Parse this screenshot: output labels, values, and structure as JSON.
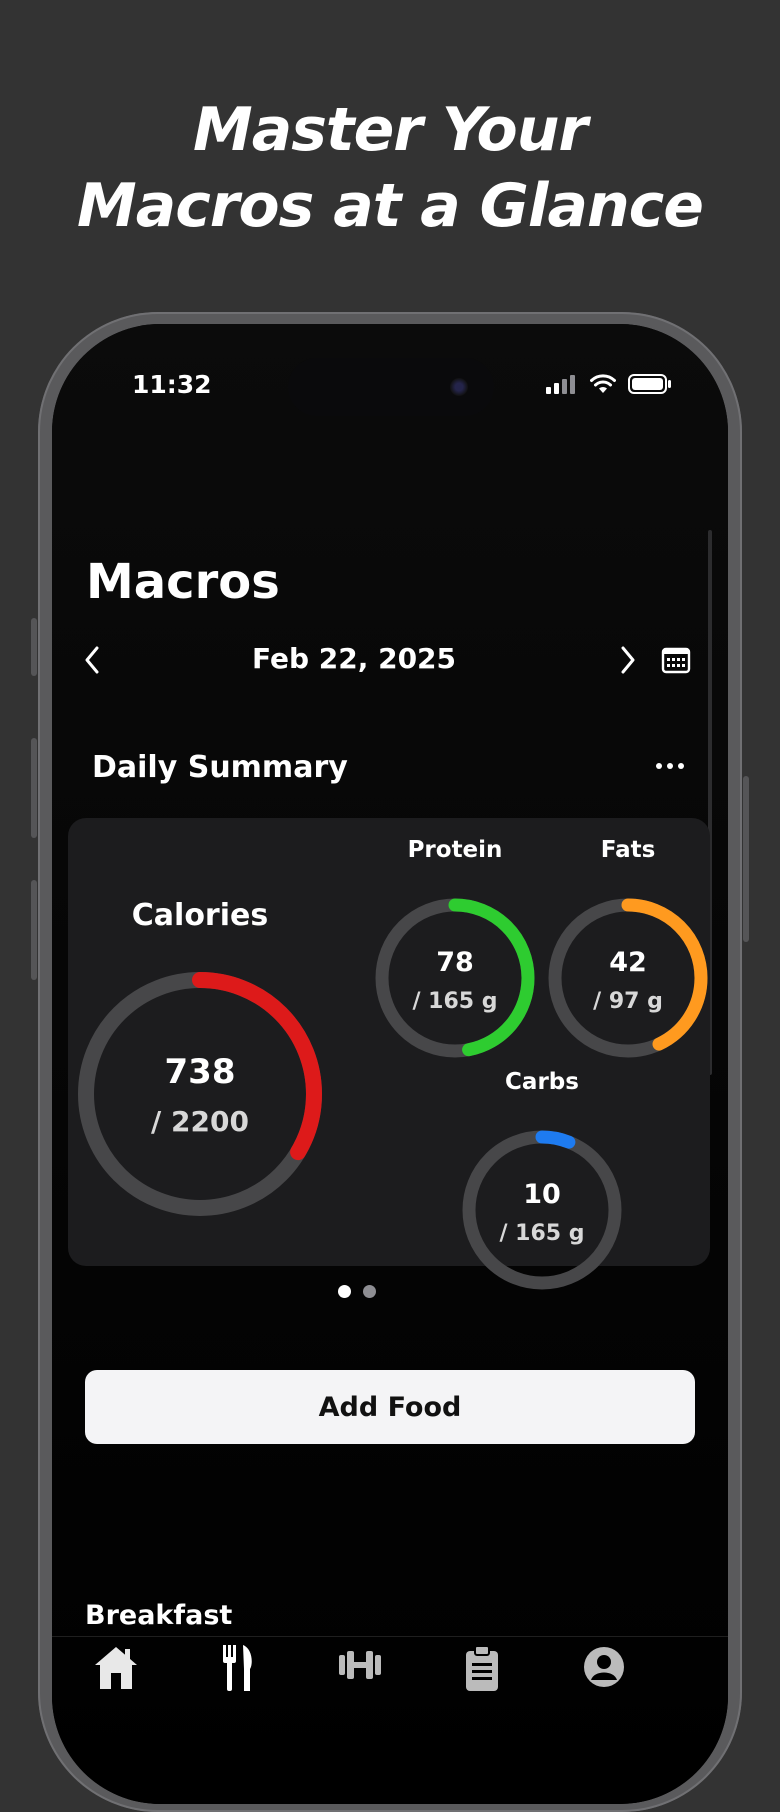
{
  "promo": {
    "headline_line1": "Master Your",
    "headline_line2": "Macros at a Glance"
  },
  "status_bar": {
    "time": "11:32"
  },
  "page": {
    "title": "Macros",
    "date": "Feb 22, 2025"
  },
  "summary": {
    "title": "Daily Summary",
    "rings": [
      {
        "label": "Calories",
        "value": "738",
        "goal": "/ 2200",
        "fraction": 0.335,
        "color": "#dd1a1a"
      },
      {
        "label": "Protein",
        "value": "78",
        "goal": "/ 165 g",
        "fraction": 0.47,
        "color": "#2ecc30"
      },
      {
        "label": "Fats",
        "value": "42",
        "goal": "/ 97 g",
        "fraction": 0.43,
        "color": "#ff9a1f"
      },
      {
        "label": "Carbs",
        "value": "10",
        "goal": "/ 165 g",
        "fraction": 0.06,
        "color": "#1e7bf0"
      }
    ],
    "track_color": "#474749",
    "page_dots": {
      "count": 2,
      "active": 0
    }
  },
  "actions": {
    "add_food_label": "Add Food"
  },
  "meals": {
    "first_section": "Breakfast"
  },
  "tabs": [
    {
      "name": "home-icon"
    },
    {
      "name": "fork-knife-icon"
    },
    {
      "name": "dumbbell-icon"
    },
    {
      "name": "clipboard-icon"
    },
    {
      "name": "profile-icon"
    }
  ]
}
